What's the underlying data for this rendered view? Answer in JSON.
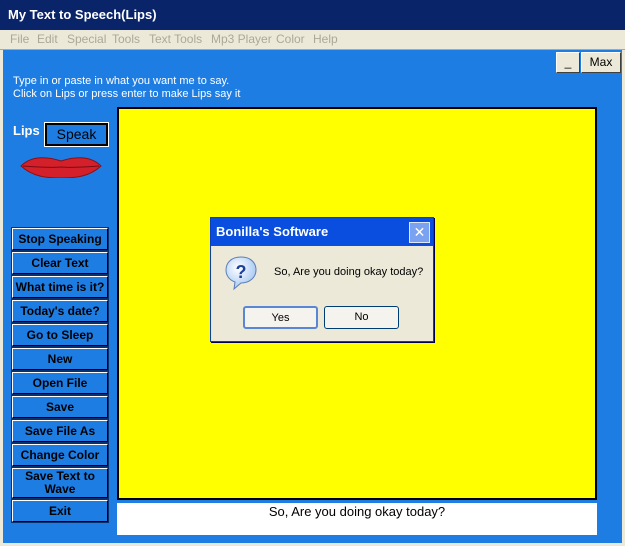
{
  "window": {
    "title": "My Text to Speech(Lips)"
  },
  "menu": [
    "File",
    "Edit",
    "Special",
    "Tools",
    "Text Tools",
    "Mp3 Player",
    "Color",
    "Help"
  ],
  "window_buttons": {
    "minimize": "_",
    "maximize": "Max"
  },
  "instructions": {
    "line1": "Type in or paste in what you want me to say.",
    "line2": "Click on Lips or press enter to make Lips say it"
  },
  "lips_label": "Lips",
  "speak_label": "Speak",
  "sidebar_buttons": [
    "Stop Speaking",
    "Clear Text",
    "What time is it?",
    "Today's date?",
    "Go to Sleep",
    "New",
    "Open File",
    "Save",
    "Save File As",
    "Change Color",
    "Save Text to Wave",
    "Exit"
  ],
  "spoken_text": "So, Are you doing okay today?",
  "dialog": {
    "title": "Bonilla's Software",
    "message": "So, Are you doing okay today?",
    "yes_label": "Yes",
    "no_label": "No"
  },
  "colors": {
    "background_blue": "#1e7de3",
    "display_yellow": "#ffff00",
    "lips_red": "#d4202a"
  }
}
